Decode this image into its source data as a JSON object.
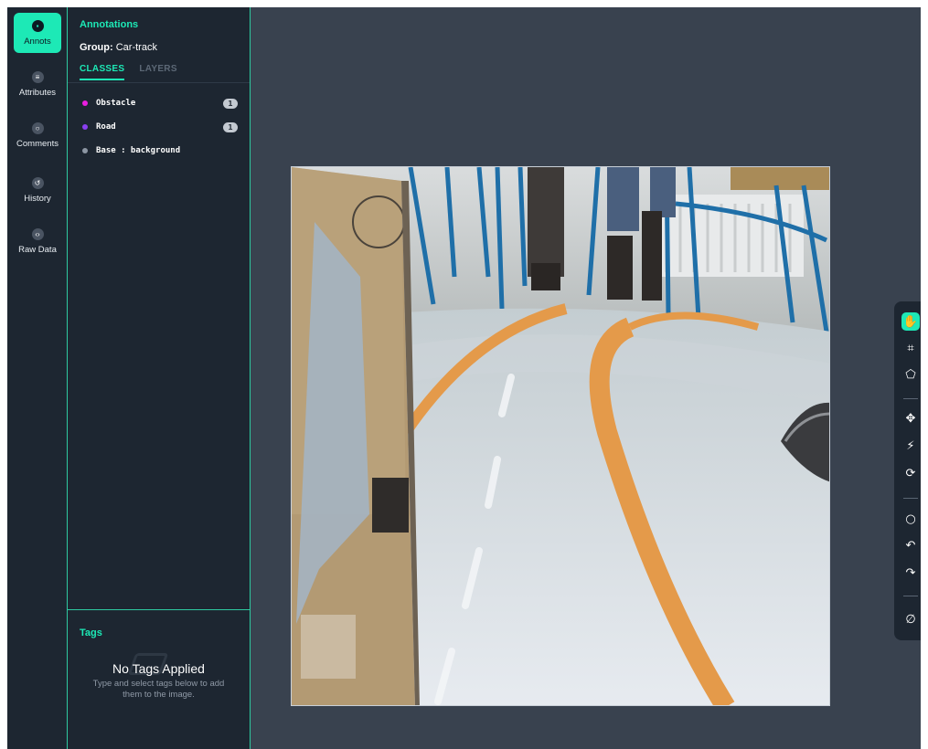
{
  "sidebar": {
    "items": [
      {
        "label": "Annots",
        "icon": "annotations-icon",
        "active": true
      },
      {
        "label": "Attributes",
        "icon": "list-icon",
        "active": false
      },
      {
        "label": "Comments",
        "icon": "comment-icon",
        "active": false
      },
      {
        "label": "History",
        "icon": "history-icon",
        "active": false
      },
      {
        "label": "Raw Data",
        "icon": "code-icon",
        "active": false
      }
    ]
  },
  "panel": {
    "title": "Annotations",
    "group_label": "Group:",
    "group_value": "Car-track",
    "tabs": [
      {
        "label": "CLASSES",
        "active": true
      },
      {
        "label": "LAYERS",
        "active": false
      }
    ],
    "classes": [
      {
        "name": "Obstacle",
        "color": "#e91ee0",
        "count": "1"
      },
      {
        "name": "Road",
        "color": "#8a3ff0",
        "count": "1"
      },
      {
        "name": "Base : background",
        "color": "#8c96a3",
        "count": ""
      }
    ]
  },
  "tags": {
    "title": "Tags",
    "empty_title": "No Tags Applied",
    "empty_subtitle": "Type and select tags below to add them to the image."
  },
  "toolbar": {
    "tools": [
      {
        "icon": "hand-pan-icon",
        "active": true
      },
      {
        "icon": "bounding-box-icon",
        "active": false
      },
      {
        "icon": "polygon-icon",
        "active": false
      },
      {
        "icon": "smart-select-icon",
        "active": false
      },
      {
        "icon": "magic-wand-icon",
        "active": false
      },
      {
        "icon": "repeat-icon",
        "active": false
      },
      {
        "icon": "comment-icon",
        "active": false
      },
      {
        "icon": "undo-icon",
        "active": false
      },
      {
        "icon": "redo-icon",
        "active": false
      },
      {
        "icon": "clear-icon",
        "active": false
      }
    ]
  },
  "colors": {
    "accent": "#1de9b6",
    "panel_bg": "#1d2631",
    "canvas_bg": "#39424f"
  }
}
